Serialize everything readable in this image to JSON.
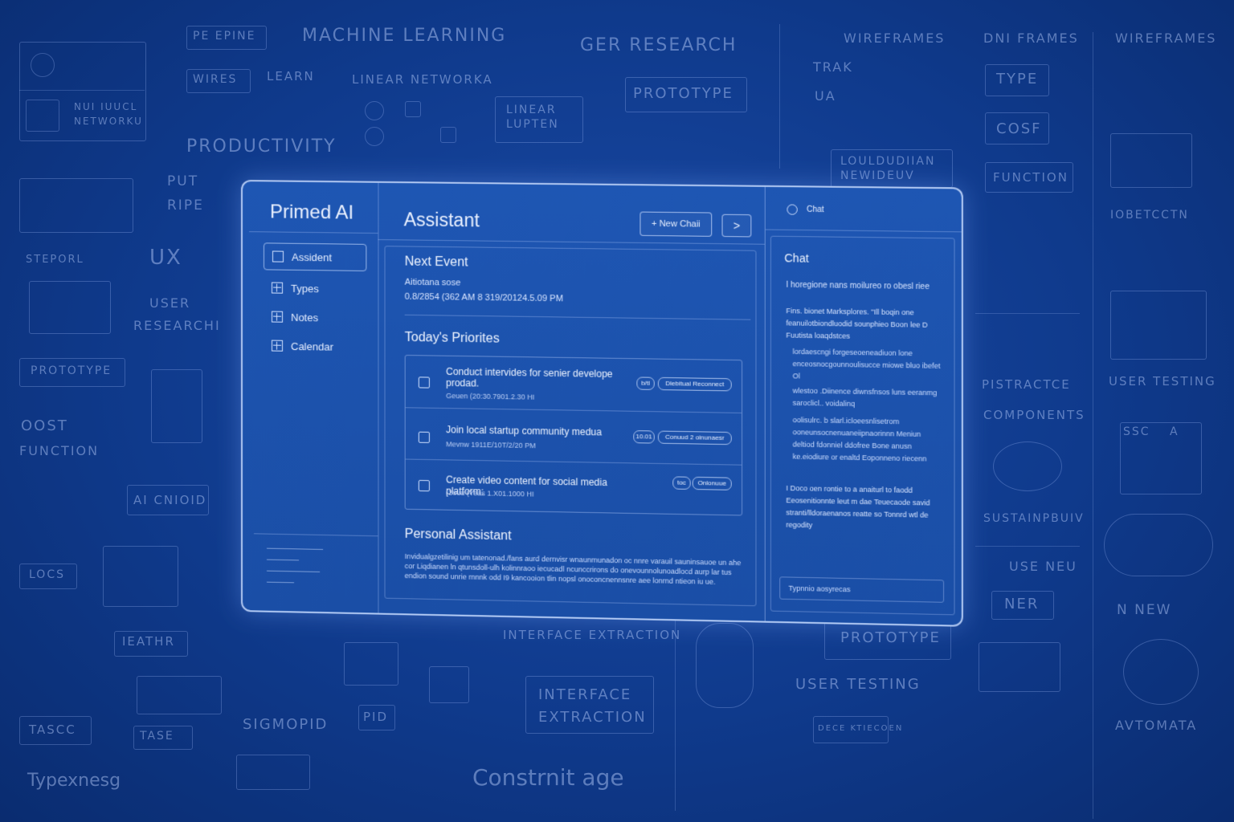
{
  "background": {
    "labels": [
      "PE EPINE",
      "WIRES",
      "LEARN",
      "MACHINE LEARNING",
      "GER RESEARCH",
      "WIREFRAMES",
      "DNI FRAMES",
      "WIREFRAMES",
      "PRODUCTIVITY",
      "LINEAR NETWORKA",
      "LINEAR LUPTEN",
      "PROTOTYPE",
      "TRAK",
      "UA",
      "TYPE",
      "COSF",
      "FUNCTION",
      "LOULDUDIIAN NEWIDEUV",
      "PUT",
      "RIPE",
      "UX",
      "USER",
      "RESEARCHI",
      "STEPORL",
      "PROTOTYPE",
      "OOST",
      "FUNCTION",
      "AI CNIOID",
      "LOCS",
      "IEATHR",
      "TASCC",
      "TASE",
      "SIGMOPID",
      "PID",
      "Typexnesg",
      "Constrnit age",
      "INTERFACE EXTRACTION",
      "INTERFACE EXTRACTION",
      "PROTOTYPE",
      "USER TESTING",
      "USE NEU",
      "NER",
      "N NEW",
      "AVTOMATA",
      "PISTRACTCE",
      "COMPONENTS",
      "SUSTAINPBUIV",
      "USER TESTING",
      "IOBETCCTN",
      "NUI IUUCL NETWORKU",
      "SSC",
      "A",
      "DECE KTIECOEN"
    ]
  },
  "sidebar": {
    "brand": "Primed AI",
    "items": [
      {
        "label": "Assident",
        "icon": "square-icon"
      },
      {
        "label": "Types",
        "icon": "plus-box-icon"
      },
      {
        "label": "Notes",
        "icon": "plus-box-icon"
      },
      {
        "label": "Calendar",
        "icon": "plus-box-icon"
      }
    ]
  },
  "header": {
    "title": "Assistant",
    "new_chat": "+ New Chaii",
    "next": ">"
  },
  "next_event": {
    "heading": "Next Event",
    "name": "Aitiotana sose",
    "time": "0.8/2854 (362 AM  8 319/20124.5.09 PM"
  },
  "priorities": {
    "heading": "Today's Priorites",
    "tasks": [
      {
        "title": "Conduct intervides for senier develope prodad.",
        "meta": "Geuen (20:30.7901.2.30 HI",
        "tag": "b/tl",
        "action": "Dlebitual Reconnect"
      },
      {
        "title": "Join local startup community medua",
        "meta": "Mevnw 1911E/10T/2/20 PM",
        "tag": "10.01",
        "action": "Conuud 2 oinunaesr"
      },
      {
        "title": "Create video content for social media platform:",
        "meta": "(2ouu (Yeas 1.X01.1000 HI",
        "tag": "toc",
        "action": "Onlonuue"
      }
    ]
  },
  "personal": {
    "heading": "Personal Assistant",
    "text": "Invidualgzetilinig um tatenonad./fans aurd dernvisr wnaunmunadon oc nnre varauil sauninsauoe un ahe cor Liqdianen ln qtunsdoll-ulh kolinnraoo iecucadl ncunccrirons do onevounnolunoadlocd aurp lar tus endion sound unrie rnnnk odd I9 kancooion tlin nopsl onoconcnennsnre aee lonrnd ntieon iu ue."
  },
  "chat": {
    "tab": "Chat",
    "heading": "Chat",
    "intro": "I horegione nans moilureo ro obesl riee",
    "message": "Fins. bionet Marksplores. \"Ill boqin one feanuilotbiondluodid sounphieo Boon lee D Fuutista loaqdstces",
    "bullets": [
      "lordaescngi forgeseoeneadiuon lone enceosnocgounnoulisucce miowe bluo ibefet Ol",
      "wlestoo .Diinence diwnsfnsos luns eeranmg saroclicl.. voidalinq",
      "oolisulrc. b slarl.icloeesnlisetrom ooneunsocnenuaneiipnaorinnn Meniun deltiod fdonniel ddofree Bone anusn ke.eiodiure or enaltd Eoponneno riecenn"
    ],
    "closing": "I Doco oen rontie to a anaiturl to faodd Eeosenitionnte leut m dae Teuecaode savid stranti/lldoraenanos reatte so Tonnrd wtl de regodity",
    "input": "Typnnio aosyrecas"
  }
}
